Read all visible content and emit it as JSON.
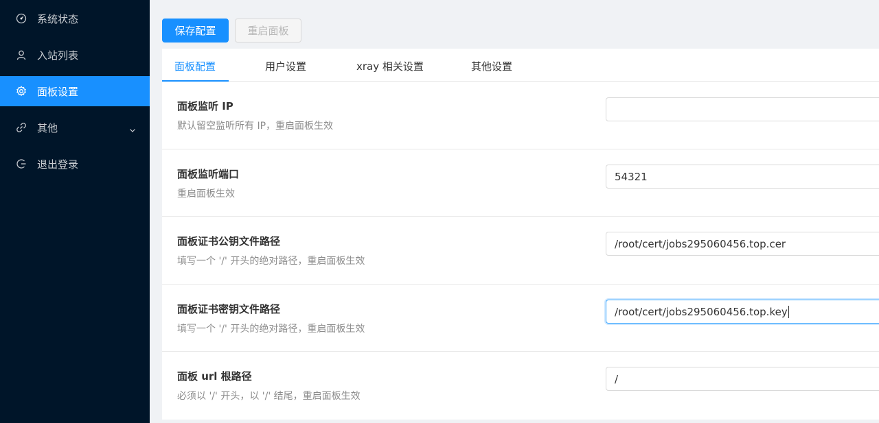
{
  "sidebar": {
    "items": [
      {
        "label": "系统状态",
        "icon": "dashboard-icon"
      },
      {
        "label": "入站列表",
        "icon": "user-icon"
      },
      {
        "label": "面板设置",
        "icon": "gear-icon",
        "active": true
      },
      {
        "label": "其他",
        "icon": "link-icon",
        "expandable": true
      },
      {
        "label": "退出登录",
        "icon": "logout-icon"
      }
    ]
  },
  "toolbar": {
    "save_label": "保存配置",
    "restart_label": "重启面板"
  },
  "tabs": [
    {
      "label": "面板配置",
      "active": true
    },
    {
      "label": "用户设置"
    },
    {
      "label": "xray 相关设置"
    },
    {
      "label": "其他设置"
    }
  ],
  "settings": [
    {
      "title": "面板监听 IP",
      "desc": "默认留空监听所有 IP，重启面板生效",
      "value": ""
    },
    {
      "title": "面板监听端口",
      "desc": "重启面板生效",
      "value": "54321"
    },
    {
      "title": "面板证书公钥文件路径",
      "desc": "填写一个 '/' 开头的绝对路径，重启面板生效",
      "value": "/root/cert/jobs295060456.top.cer"
    },
    {
      "title": "面板证书密钥文件路径",
      "desc": "填写一个 '/' 开头的绝对路径，重启面板生效",
      "value": "/root/cert/jobs295060456.top.key"
    },
    {
      "title": "面板 url 根路径",
      "desc": "必须以 '/' 开头，以 '/' 结尾，重启面板生效",
      "value": "/"
    }
  ],
  "colors": {
    "sidebar_bg": "#001529",
    "accent": "#1890ff"
  }
}
